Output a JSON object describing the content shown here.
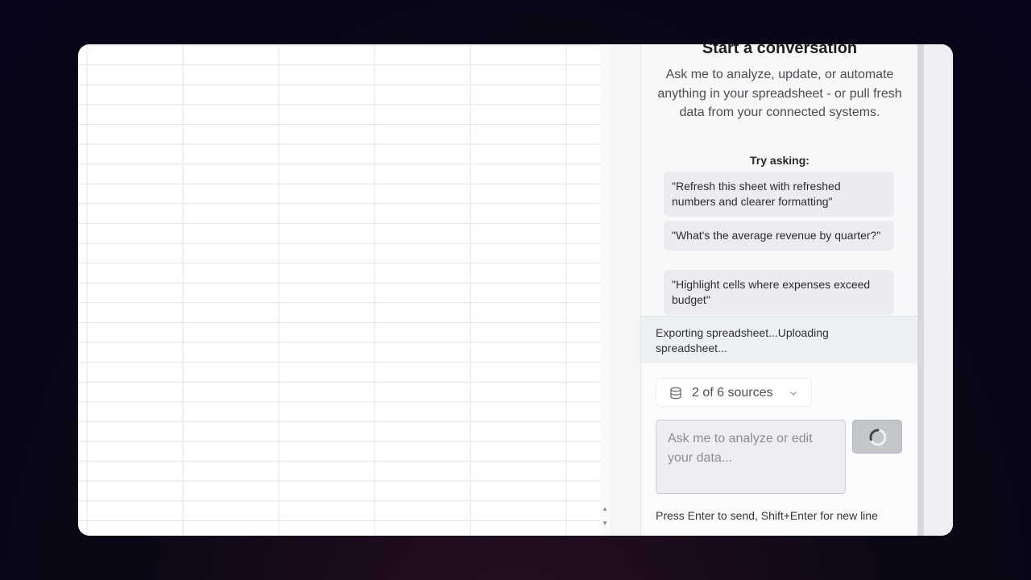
{
  "panel": {
    "title": "Start a conversation",
    "description": "Ask me to analyze, update, or automate anything in your spreadsheet - or pull fresh data from your connected systems.",
    "try_asking": "Try asking:",
    "suggestions": [
      "\"Refresh this sheet with refreshed numbers and clearer formatting\"",
      "\"What's the average revenue by quarter?\"",
      "\"Highlight cells where expenses exceed budget\""
    ],
    "status": "Exporting spreadsheet...Uploading spreadsheet...",
    "sources_label": "2 of 6 sources",
    "input_placeholder": "Ask me to analyze or edit your data...",
    "hint": "Press Enter to send, Shift+Enter for new line"
  },
  "icons": {
    "sources": "database-icon",
    "sources_dropdown": "chevron-down-icon",
    "send": "loading-spinner-icon",
    "scroll_up": "scroll-up-arrow-icon",
    "scroll_down": "scroll-down-arrow-icon"
  }
}
